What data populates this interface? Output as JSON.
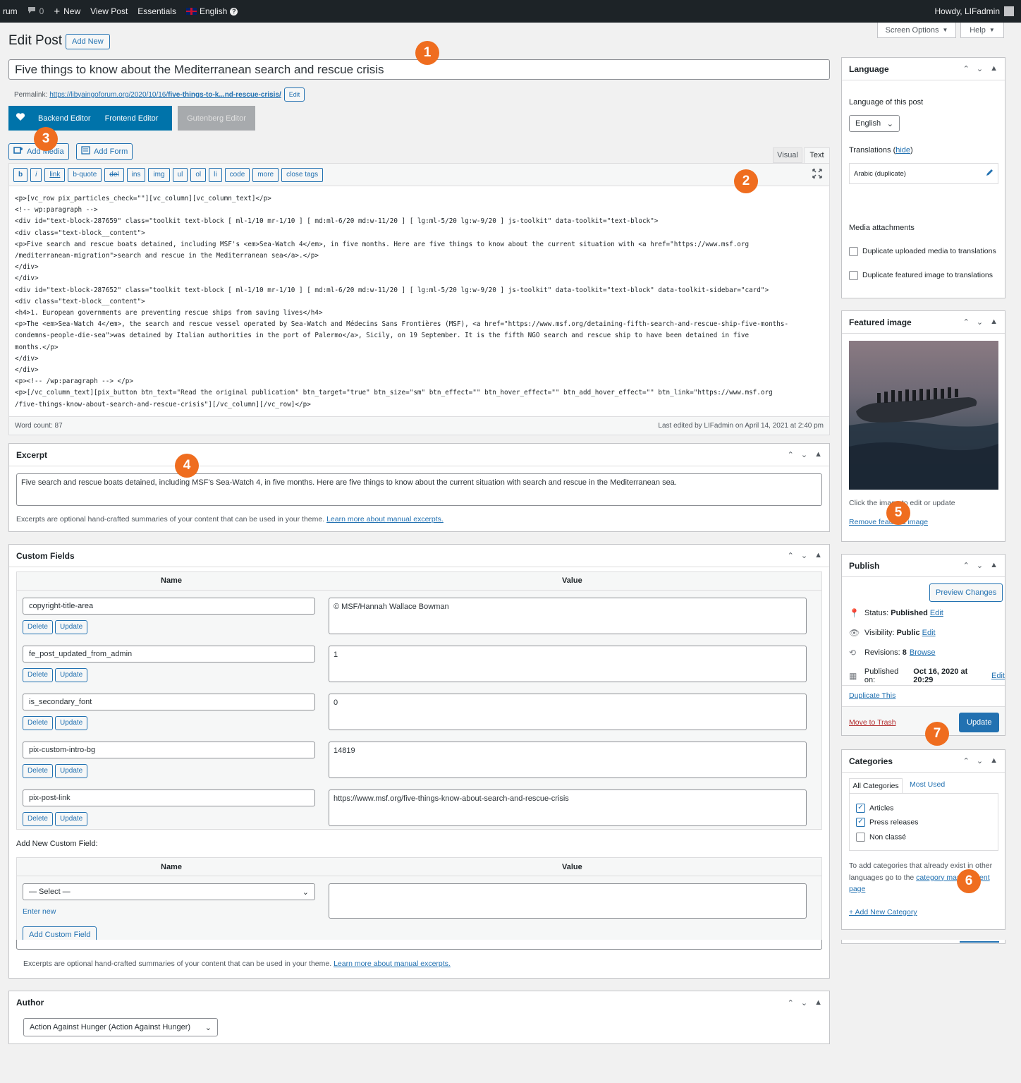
{
  "adminbar": {
    "site": "rum",
    "comments_count": "0",
    "new_label": "New",
    "view_post": "View Post",
    "essentials": "Essentials",
    "language": "English",
    "howdy": "Howdy, LIFadmin"
  },
  "screen_options": "Screen Options",
  "help": "Help",
  "page_title": "Edit Post",
  "add_new": "Add New",
  "post_title": "Five things to know about the Mediterranean search and rescue crisis",
  "permalink": {
    "label": "Permalink:",
    "url_prefix": "https://libyaingoforum.org/2020/10/16/",
    "url_slug": "five-things-to-k...nd-rescue-crisis/",
    "edit": "Edit"
  },
  "editor_tabs": {
    "backend": "Backend Editor",
    "frontend": "Frontend Editor",
    "gutenberg": "Gutenberg Editor"
  },
  "media_buttons": {
    "add_media": "Add Media",
    "add_form": "Add Form"
  },
  "mode_tabs": {
    "visual": "Visual",
    "text": "Text"
  },
  "quicktags": [
    "b",
    "i",
    "link",
    "b-quote",
    "del",
    "ins",
    "img",
    "ul",
    "ol",
    "li",
    "code",
    "more",
    "close tags"
  ],
  "content_lines": [
    "<p>[vc_row pix_particles_check=\"\"][vc_column][vc_column_text]</p>",
    "<!-- wp:paragraph -->",
    "<div id=\"text-block-287659\" class=\"toolkit text-block [ ml-1/10 mr-1/10 ] [ md:ml-6/20 md:w-11/20 ] [ lg:ml-5/20 lg:w-9/20 ] js-toolkit\" data-toolkit=\"text-block\">",
    "<div class=\"text-block__content\">",
    "<p>Five search and rescue boats detained, including MSF's <em>Sea-Watch 4</em>, in five months. Here are five things to know about the current situation with <a href=\"https://www.msf.org",
    "/mediterranean-migration\">search and rescue in the Mediterranean sea</a>.</p>",
    "</div>",
    "</div>",
    "<div id=\"text-block-287652\" class=\"toolkit text-block [ ml-1/10 mr-1/10 ] [ md:ml-6/20 md:w-11/20 ] [ lg:ml-5/20 lg:w-9/20 ] js-toolkit\" data-toolkit=\"text-block\" data-toolkit-sidebar=\"card\">",
    "<div class=\"text-block__content\">",
    "<h4>1. European governments are preventing rescue ships from saving lives</h4>",
    "<p>The <em>Sea-Watch 4</em>, the search and rescue vessel operated by Sea-Watch and Médecins Sans Frontières (MSF), <a href=\"https://www.msf.org/detaining-fifth-search-and-rescue-ship-five-months-",
    "condemns-people-die-sea\">was detained by Italian authorities in the port of Palermo</a>, Sicily, on 19 September. It is the fifth NGO search and rescue ship to have been detained in five",
    "months.</p>",
    "</div>",
    "</div>",
    "<p><!-- /wp:paragraph --> </p>",
    "<p>[/vc_column_text][pix_button btn_text=\"Read the original publication\" btn_target=\"true\" btn_size=\"sm\" btn_effect=\"\" btn_hover_effect=\"\" btn_add_hover_effect=\"\" btn_link=\"https://www.msf.org",
    "/five-things-know-about-search-and-rescue-crisis\"][/vc_column][/vc_row]</p>"
  ],
  "status_bar": {
    "word_count": "Word count: 87",
    "last_edited": "Last edited by LIFadmin on April 14, 2021 at 2:40 pm"
  },
  "excerpt": {
    "title": "Excerpt",
    "value": "Five search and rescue boats detained, including MSF's Sea-Watch 4, in five months. Here are five things to know about the current situation with search and rescue in the Mediterranean sea.",
    "help": "Excerpts are optional hand-crafted summaries of your content that can be used in your theme.",
    "help_link": "Learn more about manual excerpts."
  },
  "custom_fields": {
    "title": "Custom Fields",
    "col_name": "Name",
    "col_value": "Value",
    "delete": "Delete",
    "update": "Update",
    "rows": [
      {
        "name": "copyright-title-area",
        "value": "© MSF/Hannah Wallace Bowman"
      },
      {
        "name": "fe_post_updated_from_admin",
        "value": "1"
      },
      {
        "name": "is_secondary_font",
        "value": "0"
      },
      {
        "name": "pix-custom-intro-bg",
        "value": "14819"
      },
      {
        "name": "pix-post-link",
        "value": "https://www.msf.org/five-things-know-about-search-and-rescue-crisis"
      }
    ],
    "add_new_title": "Add New Custom Field:",
    "select_placeholder": "— Select —",
    "enter_new": "Enter new",
    "add_button": "Add Custom Field",
    "excerpt_help": "Excerpts are optional hand-crafted summaries of your content that can be used in your theme.",
    "excerpt_help_link": "Learn more about manual excerpts."
  },
  "author": {
    "title": "Author",
    "value": "Action Against Hunger (Action Against Hunger)"
  },
  "language_box": {
    "title": "Language",
    "label": "Language of this post",
    "selected": "English",
    "translations_label": "Translations",
    "hide": "hide",
    "translation_item": "Arabic (duplicate)",
    "media_title": "Media attachments",
    "dup_media": "Duplicate uploaded media to translations",
    "dup_featured": "Duplicate featured image to translations"
  },
  "featured_image": {
    "title": "Featured image",
    "hint": "Click the image to edit or update",
    "remove": "Remove featured image"
  },
  "publish": {
    "title": "Publish",
    "preview": "Preview Changes",
    "status_label": "Status:",
    "status_value": "Published",
    "visibility_label": "Visibility:",
    "visibility_value": "Public",
    "revisions_label": "Revisions:",
    "revisions_value": "8",
    "browse": "Browse",
    "published_on": "Published on:",
    "published_date": "Oct 16, 2020 at 20:29",
    "edit": "Edit",
    "duplicate": "Duplicate This",
    "trash": "Move to Trash",
    "update": "Update"
  },
  "categories": {
    "title": "Categories",
    "tab_all": "All Categories",
    "tab_used": "Most Used",
    "items": [
      {
        "label": "Articles",
        "checked": true
      },
      {
        "label": "Press releases",
        "checked": true
      },
      {
        "label": "Non classé",
        "checked": false
      }
    ],
    "note_pre": "To add categories that already exist in other languages go to the",
    "note_link": "category management page",
    "add_new": "+ Add New Category"
  },
  "markers": [
    "1",
    "2",
    "3",
    "4",
    "5",
    "6",
    "7"
  ],
  "colors": {
    "accent": "#2271b1",
    "marker": "#ef6d1f",
    "adminbar": "#1d2327",
    "trash": "#b32d2e"
  }
}
